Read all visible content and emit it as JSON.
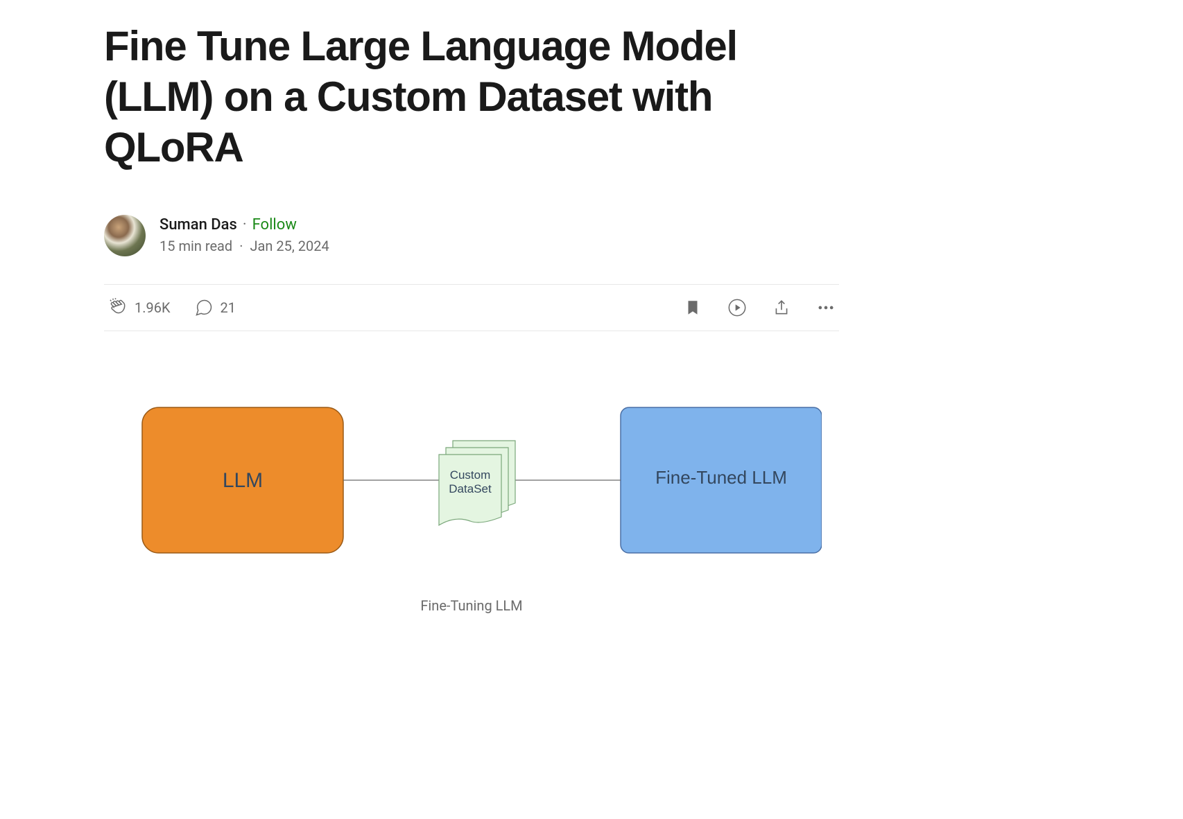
{
  "article": {
    "title": "Fine Tune Large Language Model (LLM) on a Custom Dataset with QLoRA",
    "author": "Suman Das",
    "follow_label": "Follow",
    "read_time": "15 min read",
    "date": "Jan 25, 2024"
  },
  "actions": {
    "claps": "1.96K",
    "comments": "21"
  },
  "diagram": {
    "box_left": "LLM",
    "box_middle_line1": "Custom",
    "box_middle_line2": "DataSet",
    "box_right": "Fine-Tuned LLM",
    "caption": "Fine-Tuning LLM"
  }
}
